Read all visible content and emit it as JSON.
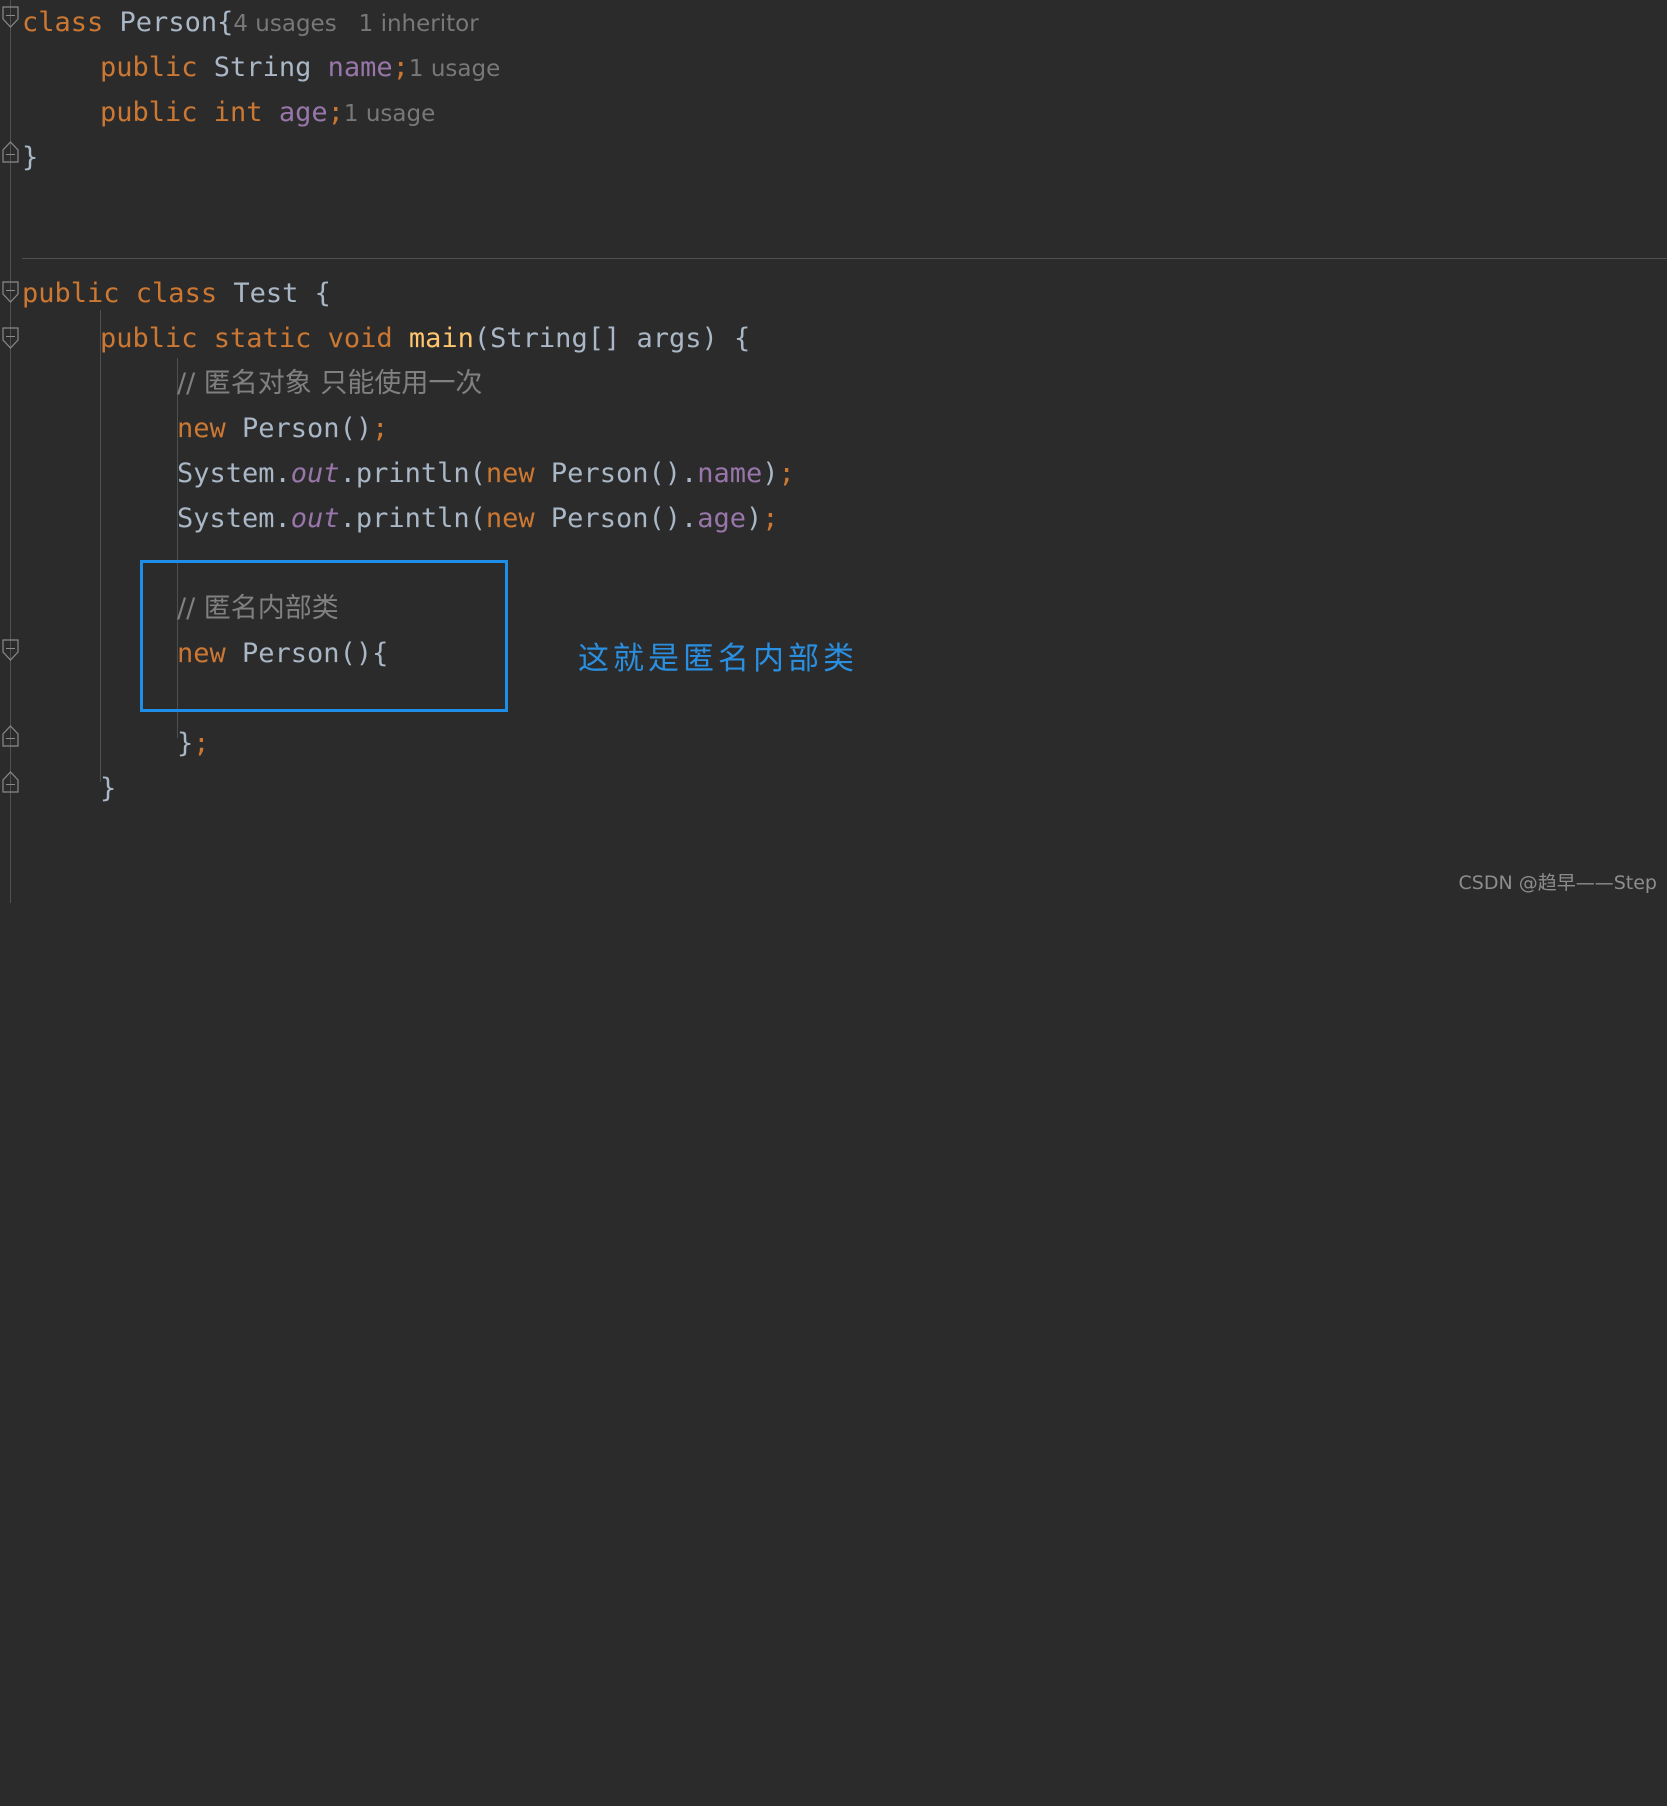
{
  "editor": {
    "theme": "darcula",
    "background": "#2b2b2b",
    "default_text_color": "#a9b7c6"
  },
  "colors": {
    "keyword": "#cc7832",
    "identifier": "#a9b7c6",
    "field": "#9876aa",
    "method": "#ffc66d",
    "comment": "#808080",
    "inlay_hint": "#787878",
    "annotation_blue": "#1e8ee8",
    "gutter_line": "#4e5254"
  },
  "code": {
    "line1": {
      "kw_class": "class ",
      "name": "Person{",
      "hint_usages": "4 usages",
      "hint_inheritor": "1 inheritor"
    },
    "line2": {
      "kw_public": "public ",
      "type": "String ",
      "field": "name",
      "semi": ";",
      "hint": "1 usage"
    },
    "line3": {
      "kw_public": "public ",
      "kw_int": "int ",
      "field": "age",
      "semi": ";",
      "hint": "1 usage"
    },
    "line4": {
      "brace": "}"
    },
    "line6": {
      "kw_public": "public ",
      "kw_class": "class ",
      "name": "Test",
      "brace": " {"
    },
    "line7": {
      "kw_public": "public ",
      "kw_static": "static ",
      "kw_void": "void ",
      "method": "main",
      "params": "(String[] args) {"
    },
    "line8": {
      "comment": "// 匿名对象 只能使用一次"
    },
    "line9": {
      "kw_new": "new ",
      "type": "Person()",
      "semi": ";"
    },
    "line10": {
      "sys": "System.",
      "out": "out",
      "println": ".println(",
      "kw_new": "new ",
      "type": "Person()",
      "dot": ".",
      "field": "name",
      "close": ")",
      "semi": ";"
    },
    "line11": {
      "sys": "System.",
      "out": "out",
      "println": ".println(",
      "kw_new": "new ",
      "type": "Person()",
      "dot": ".",
      "field": "age",
      "close": ")",
      "semi": ";"
    },
    "line13": {
      "comment": "// 匿名内部类"
    },
    "line14": {
      "kw_new": "new ",
      "type": "Person(){"
    },
    "line16": {
      "brace": "}",
      "semi": ";"
    },
    "line17": {
      "brace": "}"
    }
  },
  "annotation": {
    "highlight_label": "这就是匿名内部类"
  },
  "watermark": {
    "text": "CSDN @趋早——Step"
  }
}
